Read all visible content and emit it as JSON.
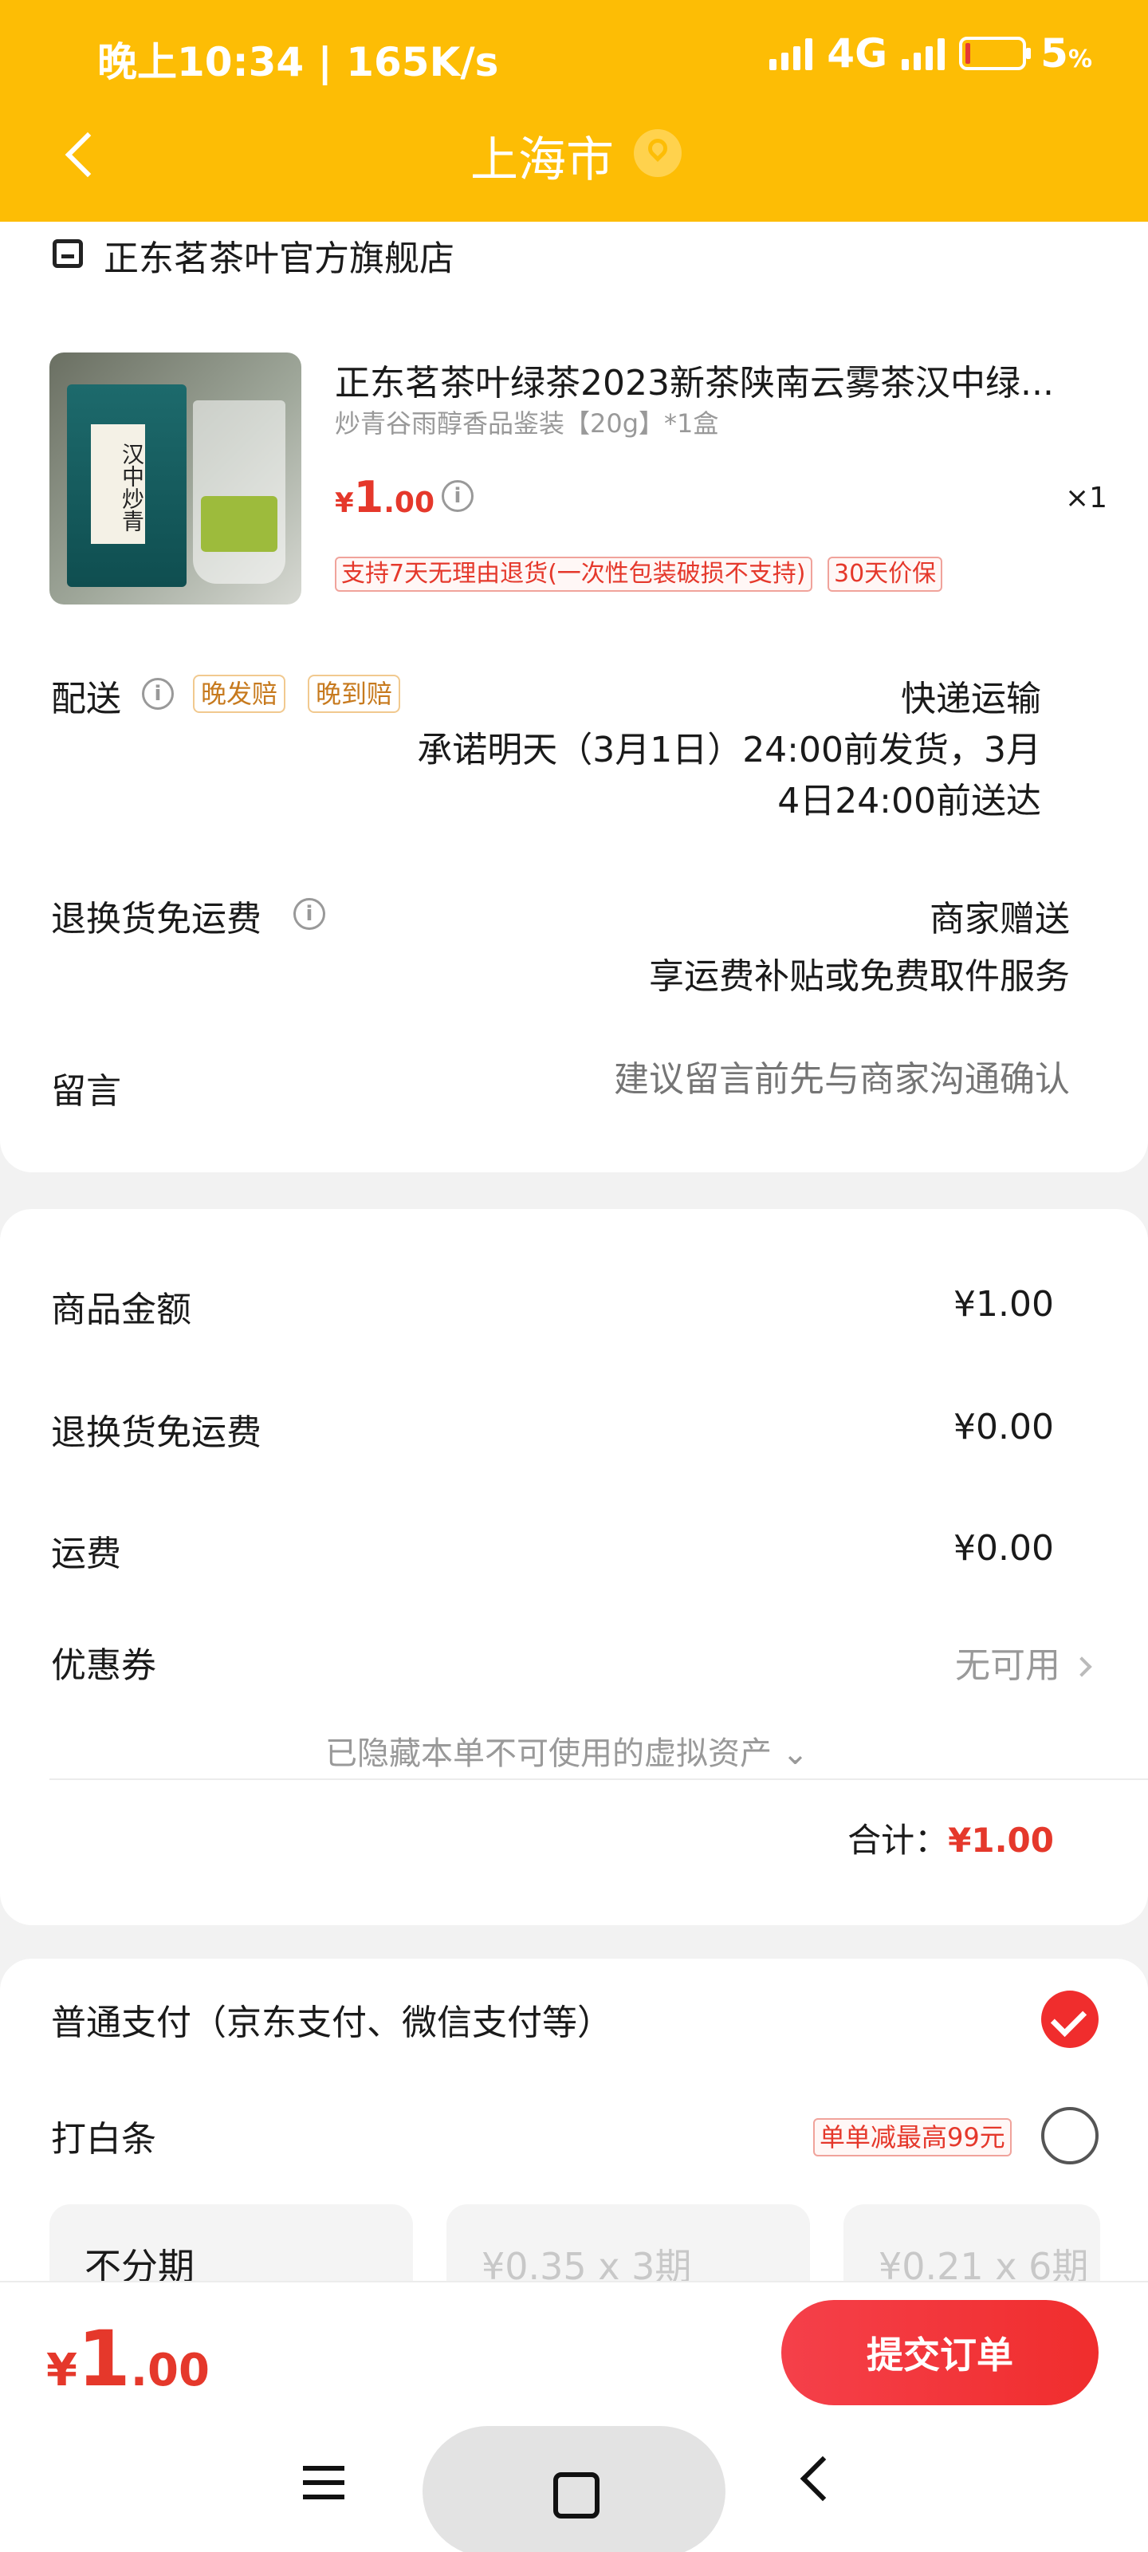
{
  "status_bar": {
    "time": "晚上10:34 | 165K/s",
    "network": "4G",
    "battery": "5",
    "battery_unit": "%"
  },
  "nav": {
    "title": "上海市"
  },
  "shop": {
    "name": "正东茗茶叶官方旗舰店"
  },
  "product": {
    "title": "正东茗茶叶绿茶2023新茶陕南云雾茶汉中绿...",
    "spec": "炒青谷雨醇香品鉴装【20g】*1盒",
    "price_currency": "¥",
    "price_int": "1",
    "price_dec": ".00",
    "qty": "×1",
    "image_text": "汉中炒青",
    "badges": [
      "支持7天无理由退货(一次性包装破损不支持)",
      "30天价保"
    ]
  },
  "delivery": {
    "label": "配送",
    "tags": [
      "晚发赔",
      "晚到赔"
    ],
    "method": "快递运输",
    "promise_line1": "承诺明天（3月1日）24:00前发货，3月",
    "promise_line2": "4日24:00前送达"
  },
  "return_shipping": {
    "label": "退换货免运费",
    "value": "商家赠送",
    "desc": "享运费补贴或免费取件服务"
  },
  "message": {
    "label": "留言",
    "placeholder": "建议留言前先与商家沟通确认"
  },
  "summary": {
    "rows": [
      {
        "label": "商品金额",
        "value": "¥1.00"
      },
      {
        "label": "退换货免运费",
        "value": "¥0.00"
      },
      {
        "label": "运费",
        "value": "¥0.00"
      }
    ],
    "coupon_label": "优惠券",
    "coupon_value": "无可用",
    "hidden_assets": "已隐藏本单不可使用的虚拟资产",
    "total_label": "合计：",
    "total_value": "¥1.00"
  },
  "payment": {
    "normal": "普通支付（京东支付、微信支付等）",
    "baitiao": "打白条",
    "baitiao_promo": "单单减最高99元",
    "plans": [
      "不分期",
      "¥0.35 x 3期",
      "¥0.21 x 6期"
    ]
  },
  "footer": {
    "currency": "¥",
    "amount_int": "1",
    "amount_dec": ".00",
    "submit": "提交订单"
  },
  "colors": {
    "header": "#fdbd05",
    "accent": "#e5382b",
    "submit": "#f02d2d"
  }
}
